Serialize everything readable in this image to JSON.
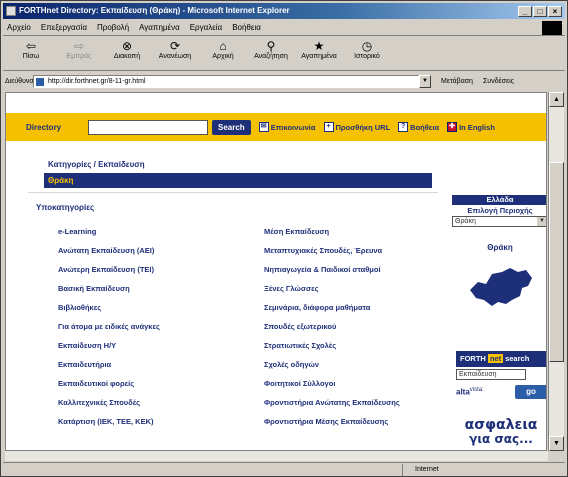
{
  "window": {
    "title": "FORTHnet Directory: Εκπαίδευση (Θράκη) - Microsoft Internet Explorer",
    "controls": [
      "_",
      "□",
      "×"
    ]
  },
  "menubar": {
    "items": [
      "Αρχείο",
      "Επεξεργασία",
      "Προβολή",
      "Αγαπημένα",
      "Εργαλεία",
      "Βοήθεια"
    ]
  },
  "toolbar": {
    "buttons": [
      {
        "label": "Πίσω",
        "icon": "back-arrow-icon",
        "glyph": "⇦"
      },
      {
        "label": "Εμπρός",
        "icon": "forward-arrow-icon",
        "glyph": "⇨"
      },
      {
        "label": "Διακοπή",
        "icon": "stop-icon",
        "glyph": "⊗"
      },
      {
        "label": "Ανανέωση",
        "icon": "refresh-icon",
        "glyph": "⟳"
      },
      {
        "label": "Αρχική",
        "icon": "home-icon",
        "glyph": "⌂"
      },
      {
        "label": "Αναζήτηση",
        "icon": "search-icon",
        "glyph": "⚲"
      },
      {
        "label": "Αγαπημένα",
        "icon": "favorites-icon",
        "glyph": "★"
      },
      {
        "label": "Ιστορικό",
        "icon": "history-icon",
        "glyph": "◷"
      }
    ]
  },
  "address": {
    "label": "Διεύθυνση",
    "url": "http://dir.forthnet.gr/8-11-gr.html",
    "go": "Μετάβαση",
    "links": "Συνδέσεις"
  },
  "page": {
    "topbar": {
      "directory_label": "Directory",
      "search_value": "",
      "search_button": "Search",
      "contact": "Επικοινωνία",
      "add_url": "Προσθήκη URL",
      "help": "Βοήθεια",
      "english": "In English"
    },
    "breadcrumb": "Κατηγορίες / Εκπαίδευση",
    "current": "Θράκη",
    "subcategories_heading": "Υποκατηγορίες",
    "col1": [
      "e-Learning",
      "Ανώτατη Εκπαίδευση (ΑΕΙ)",
      "Ανώτερη Εκπαίδευση (ΤΕΙ)",
      "Βασική Εκπαίδευση",
      "Βιβλιοθήκες",
      "Για άτομα με ειδικές ανάγκες",
      "Εκπαίδευση Η/Υ",
      "Εκπαιδευτήρια",
      "Εκπαιδευτικοί φορείς",
      "Καλλιτεχνικές Σπουδές",
      "Κατάρτιση (ΙΕΚ, ΤΕΕ, ΚΕΚ)"
    ],
    "col2": [
      "Μέση Εκπαίδευση",
      "Μεταπτυχιακές Σπουδές, Έρευνα",
      "Νηπιαγωγεία & Παιδικοί σταθμοί",
      "Ξένες Γλώσσες",
      "Σεμινάρια, διάφορα μαθήματα",
      "Σπουδές εξωτερικού",
      "Στρατιωτικές Σχολές",
      "Σχολές οδηγών",
      "Φοιτητικοί Σύλλογοι",
      "Φροντιστήρια Ανώτατης Εκπαίδευσης",
      "Φροντιστήρια Μέσης Εκπαίδευσης"
    ],
    "side": {
      "country": "Ελλάδα",
      "choose_region": "Επιλογή Περιοχής",
      "selected_region": "Θράκη",
      "region_title": "Θράκη",
      "forthnet_search": {
        "forth": "FORTH",
        "net": "net",
        "search": "search"
      },
      "search_value": "Εκπαίδευση",
      "alta": "alta",
      "vista": "vista:",
      "go": "go",
      "ad_line1": "ασφαλεια",
      "ad_line2": "για σας..."
    }
  },
  "status": {
    "left": "",
    "zone": "Internet"
  },
  "colors": {
    "navy": "#1e2f7a",
    "yellow": "#f5c000"
  }
}
